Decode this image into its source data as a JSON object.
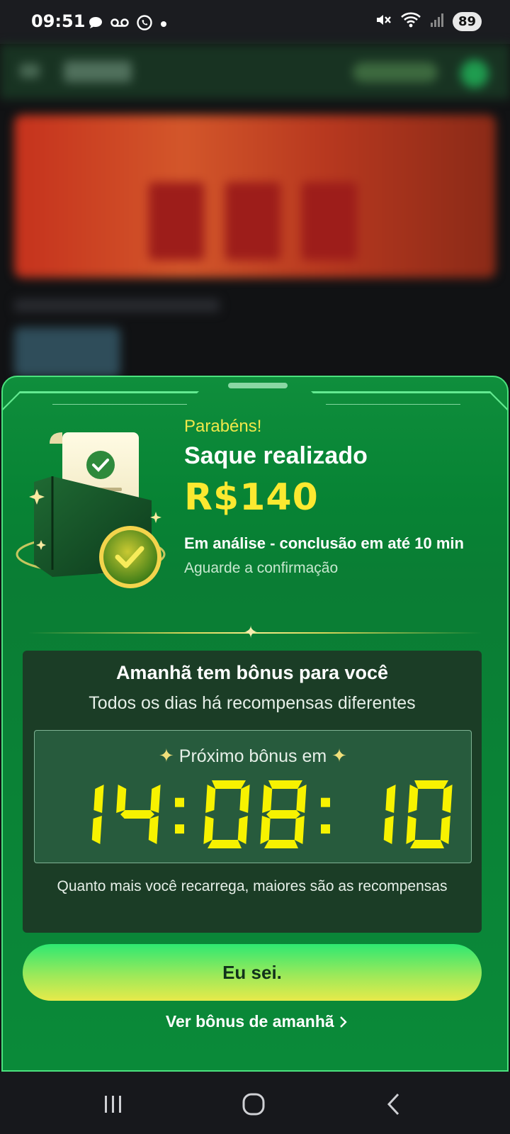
{
  "status_bar": {
    "time": "09:51",
    "battery": "89",
    "left_icons": [
      "chat-bubble-icon",
      "voicemail-icon",
      "whatsapp-icon",
      "dot-icon"
    ],
    "right_icons": [
      "mute-icon",
      "wifi-icon",
      "signal-icon"
    ]
  },
  "sheet": {
    "congrats": "Parabéns!",
    "title": "Saque realizado",
    "amount": "R$140",
    "status": "Em análise - conclusão em até 10 min",
    "wait": "Aguarde a confirmação",
    "bonus": {
      "title": "Amanhã tem bônus para você",
      "subtitle": "Todos os dias há recompensas diferentes",
      "next_label": "Próximo bônus em",
      "timer": "14:08:10",
      "note": "Quanto mais você recarrega, maiores são as recompensas"
    },
    "cta_label": "Eu sei.",
    "link_label": "Ver bônus de amanhã",
    "link_icon": "chevron-right-icon"
  },
  "colors": {
    "accent_yellow": "#fbe930",
    "sheet_green": "#0a8a39",
    "box_dark": "#1b3d26",
    "timer_digits": "#f7f200"
  },
  "nav_bar": {
    "buttons": [
      "recents-icon",
      "home-icon",
      "back-icon"
    ]
  }
}
